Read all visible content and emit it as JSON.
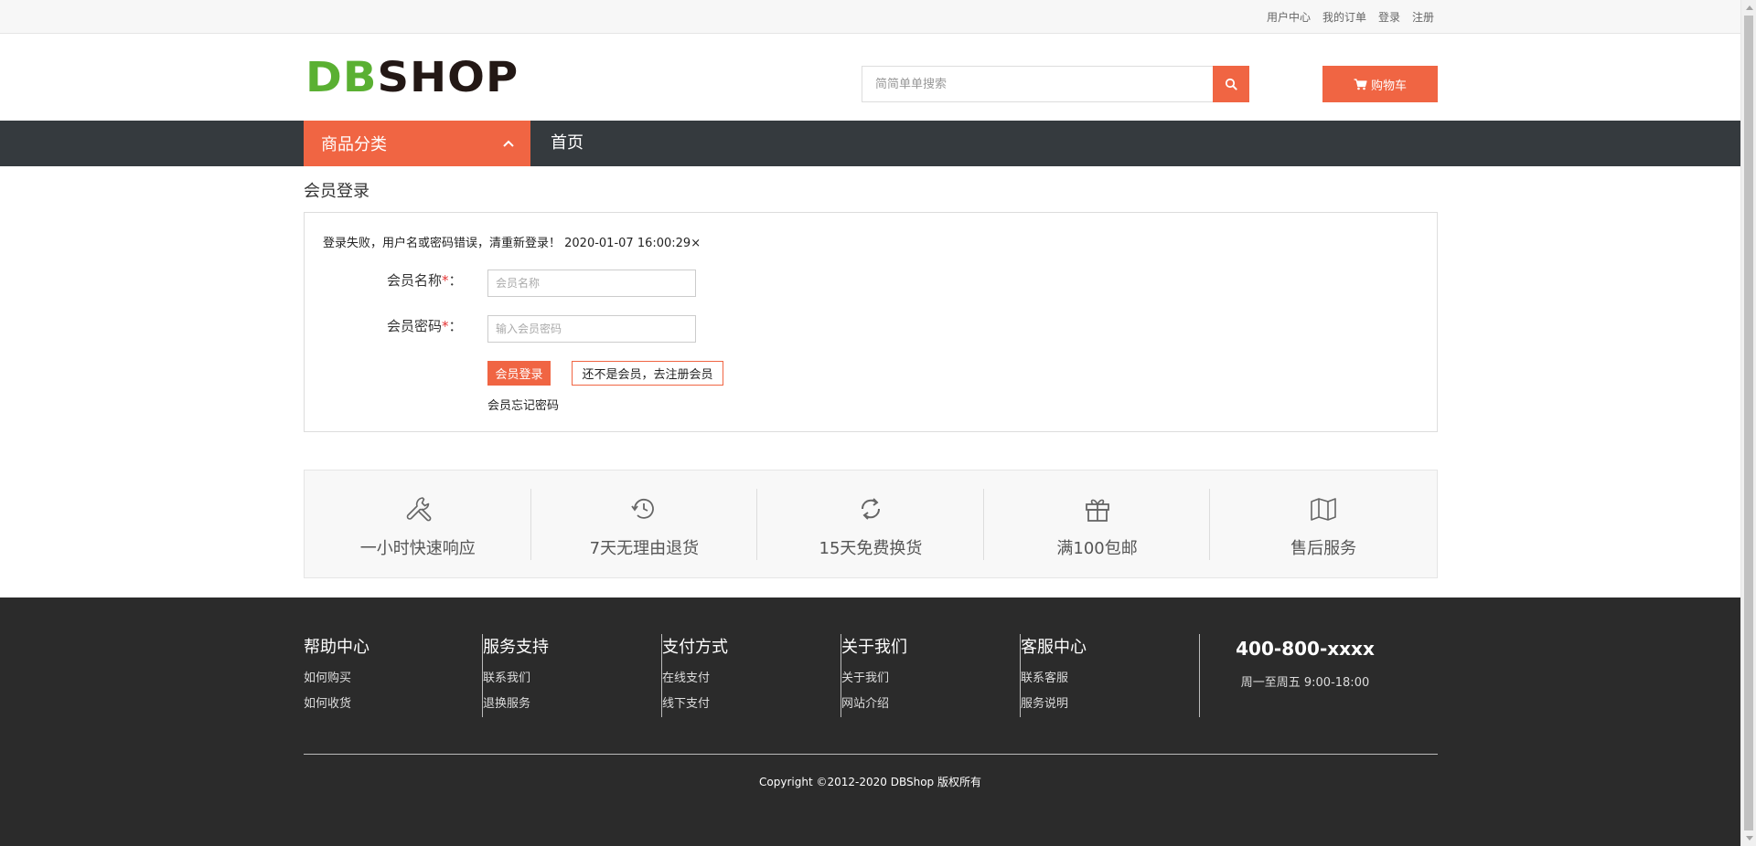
{
  "topbar": {
    "links": [
      "用户中心",
      "我的订单",
      "登录",
      "注册"
    ]
  },
  "header": {
    "logo_db": "DB",
    "logo_shop": "SHOP",
    "search_placeholder": "简简单单搜索",
    "cart_label": "购物车"
  },
  "nav": {
    "category_label": "商品分类",
    "home_label": "首页"
  },
  "login": {
    "title": "会员登录",
    "error_message": "登录失败，用户名或密码错误，清重新登录！ 2020-01-07 16:00:29×",
    "username_label": "会员名称",
    "username_placeholder": "会员名称",
    "password_label": "会员密码",
    "password_placeholder": "输入会员密码",
    "required_mark": "*",
    "colon": "：",
    "login_button": "会员登录",
    "register_button": "还不是会员，去注册会员",
    "forgot_link": "会员忘记密码"
  },
  "features": [
    {
      "icon": "wrench-icon",
      "label": "一小时快速响应"
    },
    {
      "icon": "history-icon",
      "label": "7天无理由退货"
    },
    {
      "icon": "refresh-icon",
      "label": "15天免费换货"
    },
    {
      "icon": "gift-icon",
      "label": "满100包邮"
    },
    {
      "icon": "map-icon",
      "label": "售后服务"
    }
  ],
  "footer": {
    "columns": [
      {
        "title": "帮助中心",
        "links": [
          "如何购买",
          "如何收货"
        ]
      },
      {
        "title": "服务支持",
        "links": [
          "联系我们",
          "退换服务"
        ]
      },
      {
        "title": "支付方式",
        "links": [
          "在线支付",
          "线下支付"
        ]
      },
      {
        "title": "关于我们",
        "links": [
          "关于我们",
          "网站介绍"
        ]
      },
      {
        "title": "客服中心",
        "links": [
          "联系客服",
          "服务说明"
        ]
      }
    ],
    "phone": "400-800-xxxx",
    "hours": "周一至周五 9:00-18:00",
    "copyright": "Copyright ©2012-2020 DBShop 版权所有"
  },
  "colors": {
    "accent": "#f06543",
    "nav_bg": "#353a3e",
    "footer_bg": "#2b2b2b",
    "logo_green": "#5ab032"
  }
}
